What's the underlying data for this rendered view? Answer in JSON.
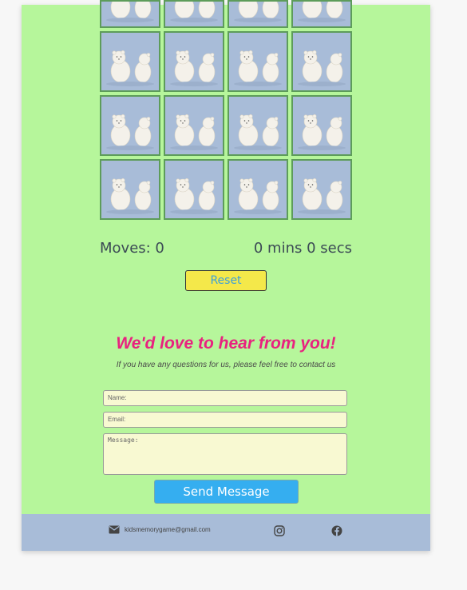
{
  "game": {
    "moves_label": "Moves: 0",
    "timer_label": "0 mins 0 secs",
    "reset_label": "Reset",
    "card_count": 16
  },
  "contact": {
    "title": "We'd love to hear from you!",
    "subtitle": "If you have any questions for us, please feel free to contact us",
    "name_placeholder": "Name:",
    "email_placeholder": "Email:",
    "message_placeholder": "Message:",
    "send_label": "Send Message"
  },
  "footer": {
    "email": "kidsmemorygame@gmail.com",
    "icons": [
      "envelope-icon",
      "instagram-icon",
      "facebook-icon"
    ]
  },
  "colors": {
    "page_bg": "#b6f69b",
    "card_bg": "#a8bcd8",
    "title_pink": "#e8227f",
    "reset_yellow": "#f4e84a",
    "send_blue": "#35aef0"
  }
}
